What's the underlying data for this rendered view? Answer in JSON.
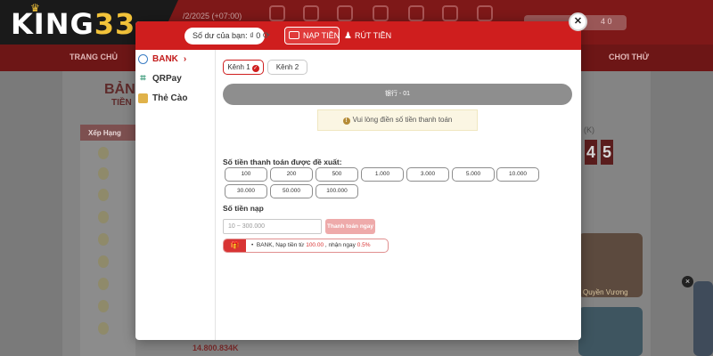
{
  "brand": {
    "logo_text_letters": "KING",
    "logo_text_number": "33"
  },
  "background": {
    "date_text": "/2/2025 (+07:00)",
    "login_hint": "4 0",
    "nav": [
      "TRANG CHỦ",
      "CHƠI THỬ"
    ],
    "heading": "BẢN",
    "subheading": "TIỀN",
    "rank_header": "Xếp Hạng",
    "jackpot_label": "(K)",
    "jackpot_digits": [
      "4",
      "5"
    ],
    "game_caption": "Quyền Vương",
    "amount_text": "14.800.834K"
  },
  "modal": {
    "balance_label": "Số dư của bạn:",
    "balance_value": "₫ 0",
    "tabs": {
      "deposit": "NẠP TIỀN",
      "withdraw": "RÚT TIỀN"
    },
    "methods": [
      {
        "label": "BANK",
        "icon": "bank-icon",
        "active": true
      },
      {
        "label": "QRPay",
        "icon": "qr-icon",
        "active": false
      },
      {
        "label": "Thẻ Cào",
        "icon": "card-icon",
        "active": false
      }
    ],
    "channels": [
      {
        "label": "Kênh 1",
        "active": true
      },
      {
        "label": "Kênh 2",
        "active": false
      }
    ],
    "bank_bar_text": "银行 - 01",
    "notice": "Vui lòng điền số tiền thanh toán",
    "suggest_label": "Số tiền thanh toán được đề xuất:",
    "suggested_amounts": [
      "100",
      "200",
      "500",
      "1.000",
      "3.000",
      "5.000",
      "10.000",
      "30.000",
      "50.000",
      "100.000"
    ],
    "amount_label": "Số tiền nạp",
    "amount_placeholder": "10 ~ 300.000",
    "amount_value": "",
    "pay_button": "Thanh toán ngay",
    "promo": {
      "prefix": "BANK,  Nạp tiền từ",
      "min": "100.00",
      "middle": ",  nhận ngay",
      "rate": "0.5%"
    }
  },
  "colors": {
    "accent": "#cf1e1e",
    "bank_bar": "#8e8e8e",
    "notice_bg": "#fbf6e3"
  }
}
